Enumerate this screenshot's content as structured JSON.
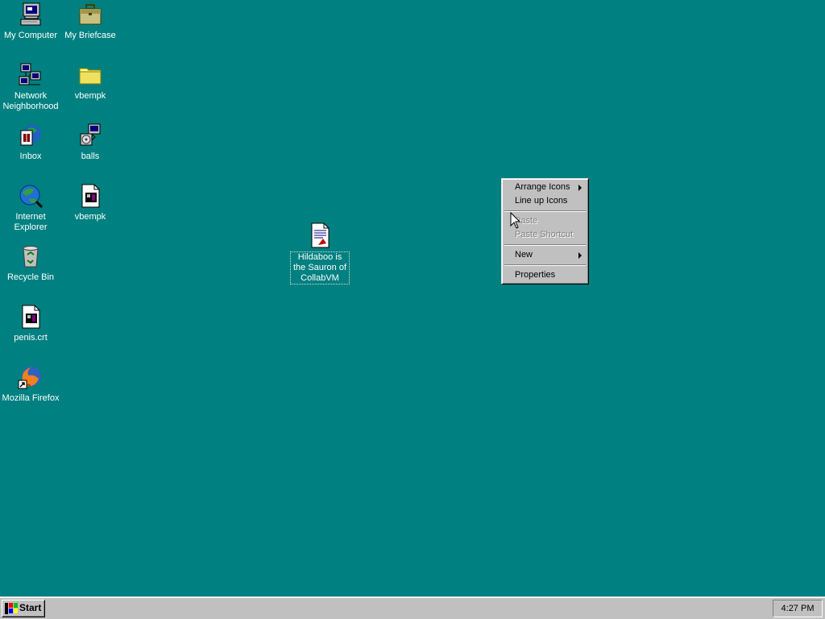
{
  "desktop": {
    "background_color": "#008080",
    "icons": [
      {
        "label": "My Computer",
        "icon": "my-computer-icon"
      },
      {
        "label": "My Briefcase",
        "icon": "briefcase-icon"
      },
      {
        "label": "Network Neighborhood",
        "icon": "network-icon"
      },
      {
        "label": "vbempk",
        "icon": "folder-icon"
      },
      {
        "label": "Inbox",
        "icon": "inbox-icon"
      },
      {
        "label": "balls",
        "icon": "setup-program-icon"
      },
      {
        "label": "Internet Explorer",
        "icon": "internet-explorer-icon"
      },
      {
        "label": "vbempk",
        "icon": "media-file-icon"
      },
      {
        "label": "Recycle Bin",
        "icon": "recycle-bin-icon"
      },
      {
        "label": "penis.crt",
        "icon": "media-file-icon"
      },
      {
        "label": "Mozilla Firefox",
        "icon": "firefox-shortcut-icon"
      },
      {
        "label": "Hildaboo is the Sauron of CollabVM",
        "icon": "document-icon"
      }
    ]
  },
  "context_menu": {
    "items": [
      {
        "label": "Arrange Icons",
        "has_submenu": true,
        "enabled": true
      },
      {
        "label": "Line up Icons",
        "has_submenu": false,
        "enabled": true
      },
      {
        "label": "Paste",
        "has_submenu": false,
        "enabled": false
      },
      {
        "label": "Paste Shortcut",
        "has_submenu": false,
        "enabled": false
      },
      {
        "label": "New",
        "has_submenu": true,
        "enabled": true
      },
      {
        "label": "Properties",
        "has_submenu": false,
        "enabled": true
      }
    ]
  },
  "taskbar": {
    "start_label": "Start",
    "clock": "4:27 PM"
  }
}
